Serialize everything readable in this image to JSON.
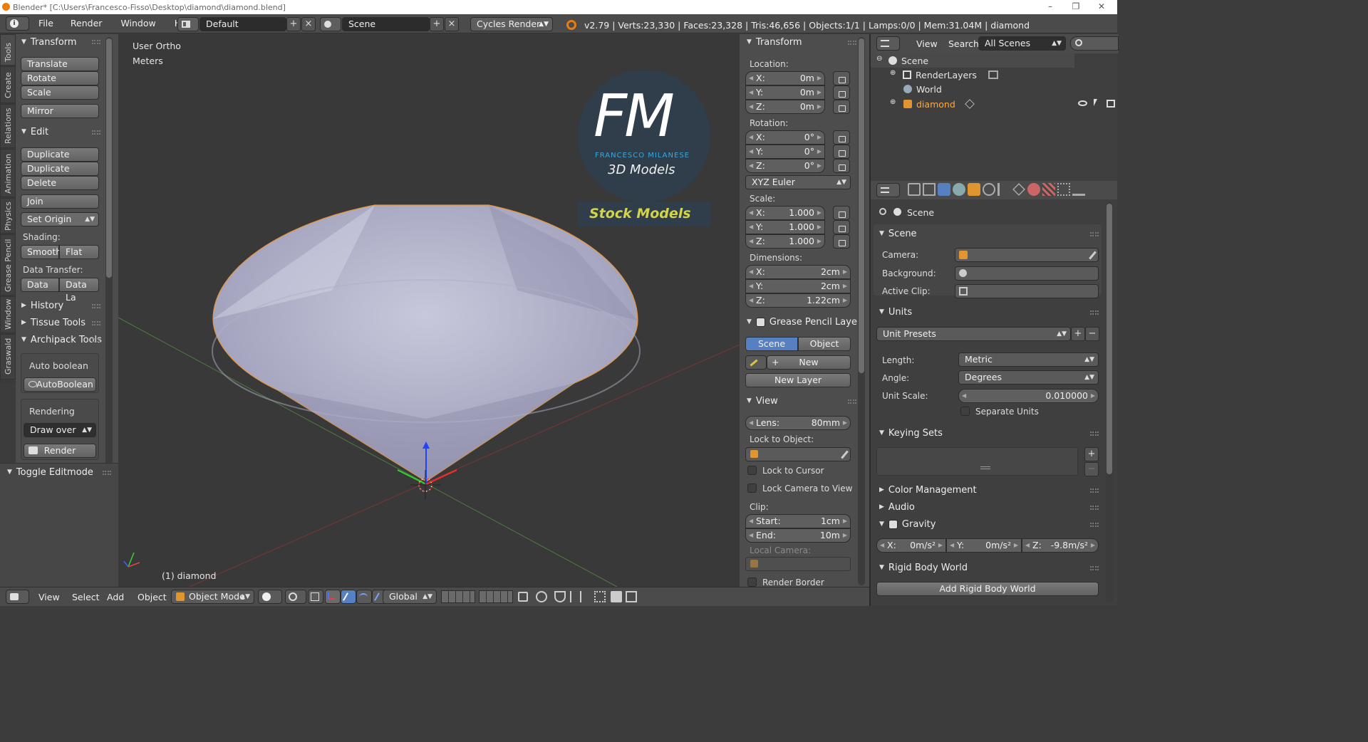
{
  "window": {
    "title": "Blender* [C:\\Users\\Francesco-Fisso\\Desktop\\diamond\\diamond.blend]",
    "minimize": "–",
    "maximize": "❐",
    "close": "✕"
  },
  "infobar": {
    "menus": [
      "File",
      "Render",
      "Window",
      "Help"
    ],
    "layout": "Default",
    "scene": "Scene",
    "engine": "Cycles Render",
    "stats": "v2.79 | Verts:23,330 | Faces:23,328 | Tris:46,656 | Objects:1/1 | Lamps:0/0 | Mem:31.04M | diamond"
  },
  "vtabs": [
    "Tools",
    "Create",
    "Relations",
    "Animation",
    "Physics",
    "Grease Pencil",
    "Window",
    "Graswald"
  ],
  "toolshelf": {
    "transform_header": "Transform",
    "translate": "Translate",
    "rotate": "Rotate",
    "scale": "Scale",
    "mirror": "Mirror",
    "edit_header": "Edit",
    "duplicate": "Duplicate",
    "duplicate_linked": "Duplicate Linked",
    "delete": "Delete",
    "join": "Join",
    "set_origin": "Set Origin",
    "shading_label": "Shading:",
    "smooth": "Smooth",
    "flat": "Flat",
    "data_transfer_label": "Data Transfer:",
    "data": "Data",
    "data_layers": "Data La",
    "history": "History",
    "tissue_tools": "Tissue Tools",
    "archipack": "Archipack Tools",
    "auto_boolean_label": "Auto boolean",
    "autoboolean_btn": "AutoBoolean",
    "rendering_label": "Rendering",
    "draw_over": "Draw over",
    "render_btn": "Render",
    "toggle_editmode": "Toggle Editmode"
  },
  "viewport": {
    "view_name": "User Ortho",
    "units": "Meters",
    "object_label": "(1) diamond",
    "logo_letters": "FM",
    "logo_name": "FRANCESCO MILANESE",
    "logo_sub": "3D Models",
    "stock": "Stock Models"
  },
  "properties": {
    "transform_header": "Transform",
    "location_label": "Location:",
    "location": [
      {
        "k": "X:",
        "v": "0m"
      },
      {
        "k": "Y:",
        "v": "0m"
      },
      {
        "k": "Z:",
        "v": "0m"
      }
    ],
    "rotation_label": "Rotation:",
    "rotation": [
      {
        "k": "X:",
        "v": "0°"
      },
      {
        "k": "Y:",
        "v": "0°"
      },
      {
        "k": "Z:",
        "v": "0°"
      }
    ],
    "rotation_mode": "XYZ Euler",
    "scale_label": "Scale:",
    "scale": [
      {
        "k": "X:",
        "v": "1.000"
      },
      {
        "k": "Y:",
        "v": "1.000"
      },
      {
        "k": "Z:",
        "v": "1.000"
      }
    ],
    "dimensions_label": "Dimensions:",
    "dimensions": [
      {
        "k": "X:",
        "v": "2cm"
      },
      {
        "k": "Y:",
        "v": "2cm"
      },
      {
        "k": "Z:",
        "v": "1.22cm"
      }
    ],
    "gp_header": "Grease Pencil Layer",
    "gp_scene": "Scene",
    "gp_object": "Object",
    "gp_new": "New",
    "gp_new_layer": "New Layer",
    "view_header": "View",
    "lens_k": "Lens:",
    "lens_v": "80mm",
    "lock_to_object": "Lock to Object:",
    "lock_to_cursor": "Lock to Cursor",
    "lock_camera": "Lock Camera to View",
    "clip_label": "Clip:",
    "clip_start_k": "Start:",
    "clip_start_v": "1cm",
    "clip_end_k": "End:",
    "clip_end_v": "10m",
    "local_camera": "Local Camera:",
    "render_border": "Render Border"
  },
  "outliner": {
    "view": "View",
    "search": "Search",
    "filter": "All Scenes",
    "items": [
      "Scene",
      "RenderLayers",
      "World",
      "diamond"
    ]
  },
  "scene_props": {
    "context": "Scene",
    "scene_header": "Scene",
    "camera": "Camera:",
    "background": "Background:",
    "active_clip": "Active Clip:",
    "units_header": "Units",
    "unit_presets": "Unit Presets",
    "length_k": "Length:",
    "length_v": "Metric",
    "angle_k": "Angle:",
    "angle_v": "Degrees",
    "unit_scale_k": "Unit Scale:",
    "unit_scale_v": "0.010000",
    "separate_units": "Separate Units",
    "keying_sets": "Keying Sets",
    "color_management": "Color Management",
    "audio": "Audio",
    "gravity": "Gravity",
    "gx_k": "X:",
    "gx_v": "0m/s²",
    "gy_k": "Y:",
    "gy_v": "0m/s²",
    "gz_k": "Z:",
    "gz_v": "-9.8m/s²",
    "rigid_body_world": "Rigid Body World",
    "add_rigid_body": "Add Rigid Body World"
  },
  "footer": {
    "view": "View",
    "select": "Select",
    "add": "Add",
    "object": "Object",
    "mode": "Object Mode",
    "orientation": "Global"
  }
}
